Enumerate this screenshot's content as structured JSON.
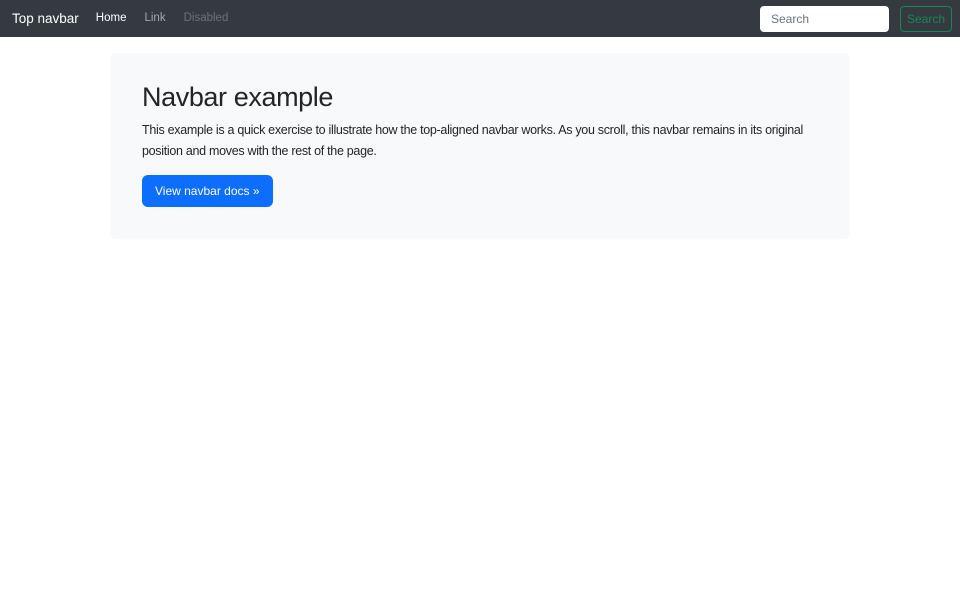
{
  "navbar": {
    "brand": "Top navbar",
    "links": [
      {
        "label": "Home",
        "state": "active"
      },
      {
        "label": "Link",
        "state": "default"
      },
      {
        "label": "Disabled",
        "state": "disabled"
      }
    ],
    "search": {
      "placeholder": "Search",
      "value": "",
      "button_label": "Search"
    }
  },
  "jumbotron": {
    "title": "Navbar example",
    "body": "This example is a quick exercise to illustrate how the top-aligned navbar works. As you scroll, this navbar remains in its original position and moves with the rest of the page.",
    "cta_label": "View navbar docs »"
  },
  "colors": {
    "navbar_bg": "#343a40",
    "box_bg": "#f8f9fa",
    "primary": "#0d6efd",
    "success": "#198754",
    "text": "#212529",
    "placeholder": "#6c757d"
  }
}
